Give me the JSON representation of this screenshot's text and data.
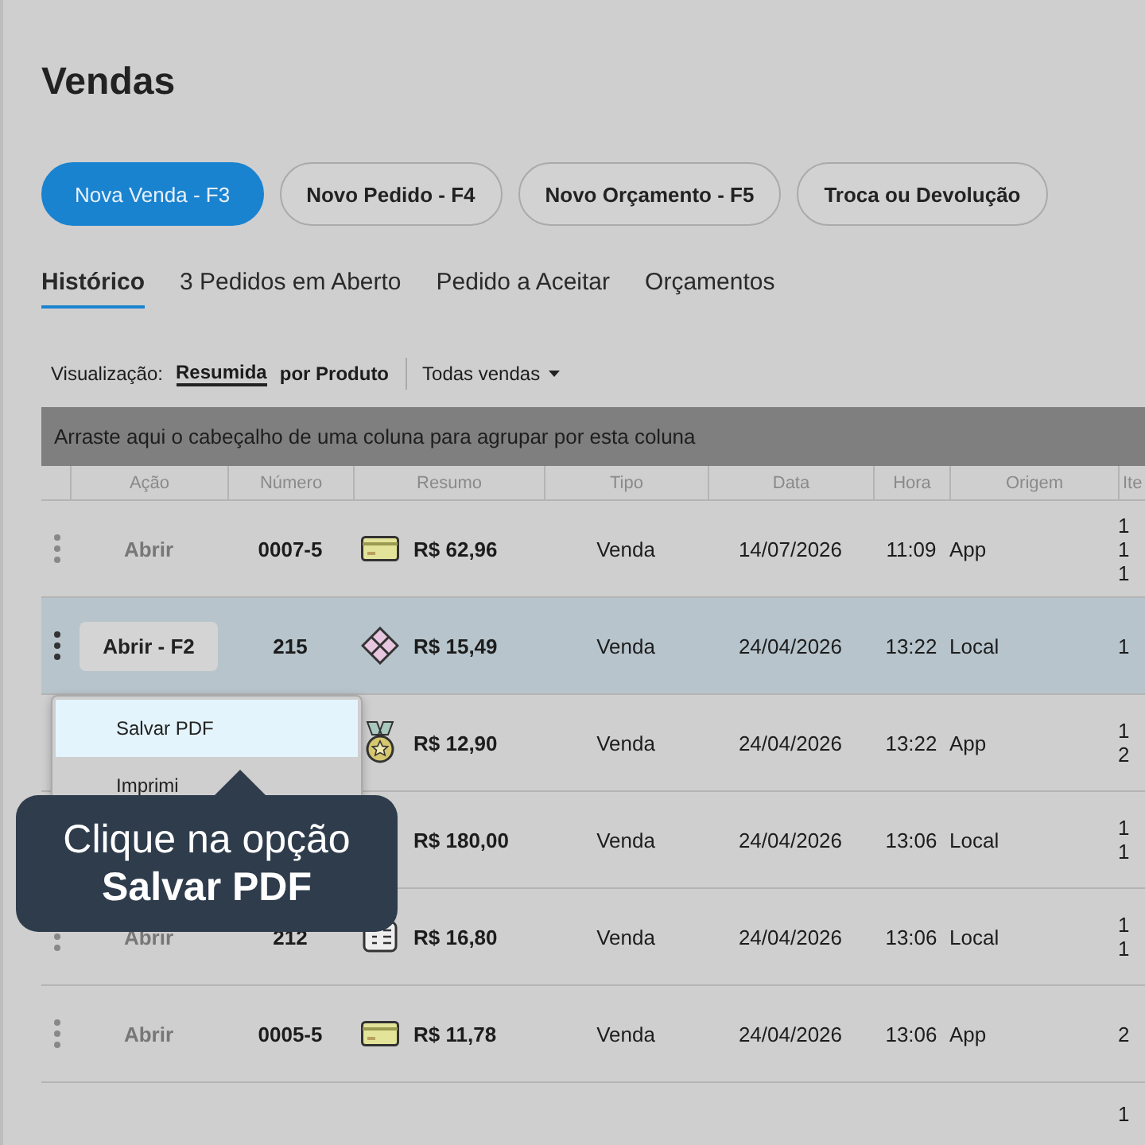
{
  "title": "Vendas",
  "actions": [
    {
      "label": "Nova Venda - F3",
      "selected": true
    },
    {
      "label": "Novo Pedido - F4",
      "selected": false
    },
    {
      "label": "Novo Orçamento - F5",
      "selected": false
    },
    {
      "label": "Troca ou Devolução",
      "selected": false
    }
  ],
  "tabs": [
    {
      "label": "Histórico",
      "selected": true
    },
    {
      "label": "3 Pedidos em Aberto",
      "selected": false
    },
    {
      "label": "Pedido a Aceitar",
      "selected": false
    },
    {
      "label": "Orçamentos",
      "selected": false
    }
  ],
  "view": {
    "label": "Visualização:",
    "options": [
      {
        "label": "Resumida",
        "selected": true
      },
      {
        "label": "por Produto",
        "selected": false
      }
    ],
    "filter": "Todas vendas"
  },
  "group_bar": "Arraste aqui o cabeçalho de uma coluna para agrupar por esta coluna",
  "table": {
    "columns": [
      "Ação",
      "Número",
      "Resumo",
      "Tipo",
      "Data",
      "Hora",
      "Origem",
      "Ite"
    ],
    "rows": [
      {
        "selected": false,
        "action": "Abrir",
        "number": "0007-5",
        "kind": "card",
        "total": "R$ 62,96",
        "type": "Venda",
        "date": "14/07/2026",
        "time": "11:09",
        "origin": "App",
        "items": [
          "1",
          "1",
          "1"
        ]
      },
      {
        "selected": true,
        "action": "Abrir - F2",
        "number": "215",
        "kind": "diamond",
        "total": "R$ 15,49",
        "type": "Venda",
        "date": "24/04/2026",
        "time": "13:22",
        "origin": "Local",
        "items": [
          "1"
        ]
      },
      {
        "selected": false,
        "kind": "medal",
        "total": "R$ 12,90",
        "type": "Venda",
        "date": "24/04/2026",
        "time": "13:22",
        "origin": "App",
        "items": [
          "1",
          "2"
        ]
      },
      {
        "selected": false,
        "total": "R$ 180,00",
        "type": "Venda",
        "date": "24/04/2026",
        "time": "13:06",
        "origin": "Local",
        "items": [
          "1",
          "1"
        ]
      },
      {
        "selected": false,
        "action": "Abrir",
        "number": "212",
        "kind": "bill",
        "total": "R$ 16,80",
        "type": "Venda",
        "date": "24/04/2026",
        "time": "13:06",
        "origin": "Local",
        "items": [
          "1",
          "1"
        ]
      },
      {
        "selected": false,
        "action": "Abrir",
        "number": "0005-5",
        "kind": "card",
        "total": "R$ 11,78",
        "type": "Venda",
        "date": "24/04/2026",
        "time": "13:06",
        "origin": "App",
        "items": [
          "2"
        ]
      },
      {
        "selected": false,
        "items": [
          "1"
        ]
      }
    ]
  },
  "menu": [
    {
      "label": "Salvar PDF",
      "selected": true
    },
    {
      "label": "Imprimi",
      "selected": false
    }
  ],
  "tooltip": {
    "line1": "Clique na opção",
    "line2": "Salvar PDF"
  }
}
